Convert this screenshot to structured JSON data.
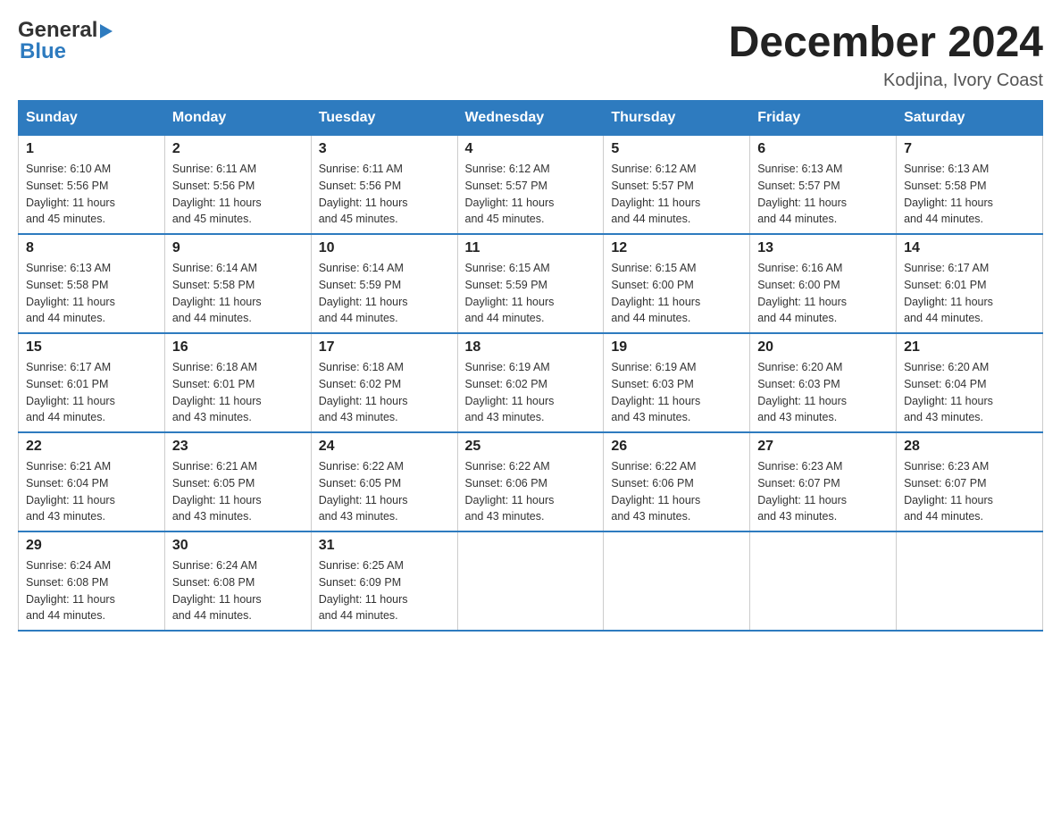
{
  "header": {
    "logo_line1": "General",
    "logo_line2": "Blue",
    "title": "December 2024",
    "location": "Kodjina, Ivory Coast"
  },
  "days_of_week": [
    "Sunday",
    "Monday",
    "Tuesday",
    "Wednesday",
    "Thursday",
    "Friday",
    "Saturday"
  ],
  "weeks": [
    [
      {
        "day": "1",
        "info": "Sunrise: 6:10 AM\nSunset: 5:56 PM\nDaylight: 11 hours\nand 45 minutes."
      },
      {
        "day": "2",
        "info": "Sunrise: 6:11 AM\nSunset: 5:56 PM\nDaylight: 11 hours\nand 45 minutes."
      },
      {
        "day": "3",
        "info": "Sunrise: 6:11 AM\nSunset: 5:56 PM\nDaylight: 11 hours\nand 45 minutes."
      },
      {
        "day": "4",
        "info": "Sunrise: 6:12 AM\nSunset: 5:57 PM\nDaylight: 11 hours\nand 45 minutes."
      },
      {
        "day": "5",
        "info": "Sunrise: 6:12 AM\nSunset: 5:57 PM\nDaylight: 11 hours\nand 44 minutes."
      },
      {
        "day": "6",
        "info": "Sunrise: 6:13 AM\nSunset: 5:57 PM\nDaylight: 11 hours\nand 44 minutes."
      },
      {
        "day": "7",
        "info": "Sunrise: 6:13 AM\nSunset: 5:58 PM\nDaylight: 11 hours\nand 44 minutes."
      }
    ],
    [
      {
        "day": "8",
        "info": "Sunrise: 6:13 AM\nSunset: 5:58 PM\nDaylight: 11 hours\nand 44 minutes."
      },
      {
        "day": "9",
        "info": "Sunrise: 6:14 AM\nSunset: 5:58 PM\nDaylight: 11 hours\nand 44 minutes."
      },
      {
        "day": "10",
        "info": "Sunrise: 6:14 AM\nSunset: 5:59 PM\nDaylight: 11 hours\nand 44 minutes."
      },
      {
        "day": "11",
        "info": "Sunrise: 6:15 AM\nSunset: 5:59 PM\nDaylight: 11 hours\nand 44 minutes."
      },
      {
        "day": "12",
        "info": "Sunrise: 6:15 AM\nSunset: 6:00 PM\nDaylight: 11 hours\nand 44 minutes."
      },
      {
        "day": "13",
        "info": "Sunrise: 6:16 AM\nSunset: 6:00 PM\nDaylight: 11 hours\nand 44 minutes."
      },
      {
        "day": "14",
        "info": "Sunrise: 6:17 AM\nSunset: 6:01 PM\nDaylight: 11 hours\nand 44 minutes."
      }
    ],
    [
      {
        "day": "15",
        "info": "Sunrise: 6:17 AM\nSunset: 6:01 PM\nDaylight: 11 hours\nand 44 minutes."
      },
      {
        "day": "16",
        "info": "Sunrise: 6:18 AM\nSunset: 6:01 PM\nDaylight: 11 hours\nand 43 minutes."
      },
      {
        "day": "17",
        "info": "Sunrise: 6:18 AM\nSunset: 6:02 PM\nDaylight: 11 hours\nand 43 minutes."
      },
      {
        "day": "18",
        "info": "Sunrise: 6:19 AM\nSunset: 6:02 PM\nDaylight: 11 hours\nand 43 minutes."
      },
      {
        "day": "19",
        "info": "Sunrise: 6:19 AM\nSunset: 6:03 PM\nDaylight: 11 hours\nand 43 minutes."
      },
      {
        "day": "20",
        "info": "Sunrise: 6:20 AM\nSunset: 6:03 PM\nDaylight: 11 hours\nand 43 minutes."
      },
      {
        "day": "21",
        "info": "Sunrise: 6:20 AM\nSunset: 6:04 PM\nDaylight: 11 hours\nand 43 minutes."
      }
    ],
    [
      {
        "day": "22",
        "info": "Sunrise: 6:21 AM\nSunset: 6:04 PM\nDaylight: 11 hours\nand 43 minutes."
      },
      {
        "day": "23",
        "info": "Sunrise: 6:21 AM\nSunset: 6:05 PM\nDaylight: 11 hours\nand 43 minutes."
      },
      {
        "day": "24",
        "info": "Sunrise: 6:22 AM\nSunset: 6:05 PM\nDaylight: 11 hours\nand 43 minutes."
      },
      {
        "day": "25",
        "info": "Sunrise: 6:22 AM\nSunset: 6:06 PM\nDaylight: 11 hours\nand 43 minutes."
      },
      {
        "day": "26",
        "info": "Sunrise: 6:22 AM\nSunset: 6:06 PM\nDaylight: 11 hours\nand 43 minutes."
      },
      {
        "day": "27",
        "info": "Sunrise: 6:23 AM\nSunset: 6:07 PM\nDaylight: 11 hours\nand 43 minutes."
      },
      {
        "day": "28",
        "info": "Sunrise: 6:23 AM\nSunset: 6:07 PM\nDaylight: 11 hours\nand 44 minutes."
      }
    ],
    [
      {
        "day": "29",
        "info": "Sunrise: 6:24 AM\nSunset: 6:08 PM\nDaylight: 11 hours\nand 44 minutes."
      },
      {
        "day": "30",
        "info": "Sunrise: 6:24 AM\nSunset: 6:08 PM\nDaylight: 11 hours\nand 44 minutes."
      },
      {
        "day": "31",
        "info": "Sunrise: 6:25 AM\nSunset: 6:09 PM\nDaylight: 11 hours\nand 44 minutes."
      },
      {
        "day": "",
        "info": ""
      },
      {
        "day": "",
        "info": ""
      },
      {
        "day": "",
        "info": ""
      },
      {
        "day": "",
        "info": ""
      }
    ]
  ]
}
